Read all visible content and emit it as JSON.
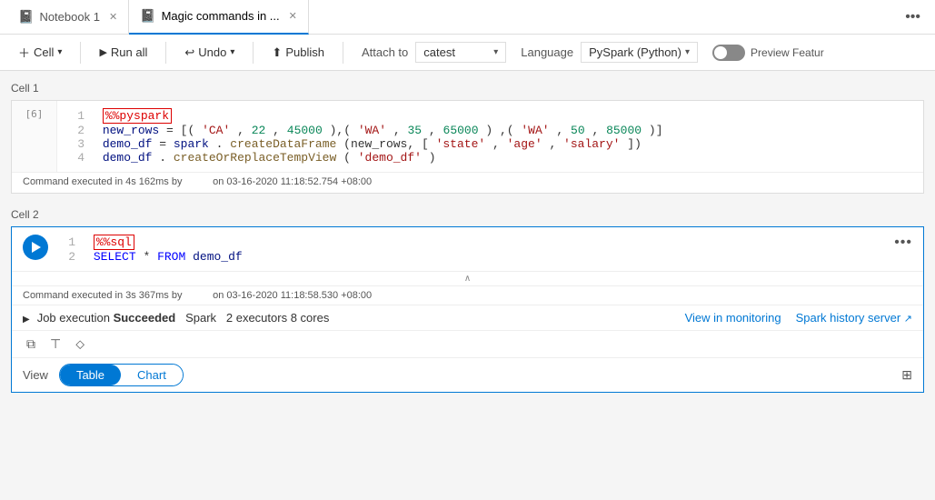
{
  "tabs": [
    {
      "id": "tab-notebook1",
      "icon": "📓",
      "label": "Notebook 1",
      "active": false,
      "closable": true
    },
    {
      "id": "tab-magic",
      "icon": "📓",
      "label": "Magic commands in ...",
      "active": true,
      "closable": true
    }
  ],
  "toolbar": {
    "cell_label": "Cell",
    "run_all_label": "Run all",
    "undo_label": "Undo",
    "publish_label": "Publish",
    "attach_label": "Attach to",
    "attach_value": "catest",
    "language_label": "Language",
    "language_value": "PySpark (Python)",
    "preview_label": "Preview Featur"
  },
  "cell1": {
    "label": "Cell 1",
    "run_index": "[6]",
    "lines": [
      {
        "num": "1",
        "code": "%%pyspark",
        "type": "magic"
      },
      {
        "num": "2",
        "code": "new_rows = [('CA',22, 45000),('WA',35,65000) ,('WA',50,85000)]",
        "type": "code"
      },
      {
        "num": "3",
        "code": "demo_df = spark.createDataFrame(new_rows, ['state', 'age', 'salary'])",
        "type": "code"
      },
      {
        "num": "4",
        "code": "demo_df.createOrReplaceTempView('demo_df')",
        "type": "code"
      }
    ],
    "status": "Command executed in 4s 162ms by",
    "status_suffix": "on 03-16-2020 11:18:52.754 +08:00"
  },
  "cell2": {
    "label": "Cell 2",
    "lines": [
      {
        "num": "1",
        "code": "%%sql",
        "type": "magic"
      },
      {
        "num": "2",
        "code": "SELECT * FROM demo_df",
        "type": "sql"
      }
    ],
    "status": "Command executed in 3s 367ms by",
    "status_suffix": "on 03-16-2020 11:18:58.530 +08:00",
    "job_text_prefix": "Job execution",
    "job_status": "Succeeded",
    "job_spark": "Spark",
    "job_detail": "2 executors 8 cores",
    "view_monitoring_label": "View in monitoring",
    "spark_history_label": "Spark history server",
    "view_label": "View",
    "table_label": "Table",
    "chart_label": "Chart"
  }
}
